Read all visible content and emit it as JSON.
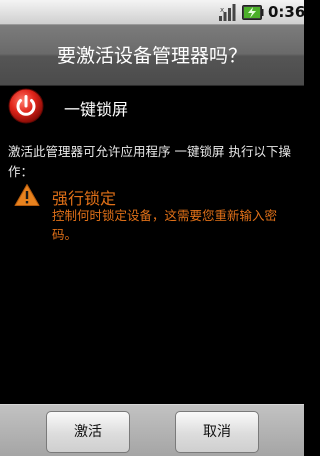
{
  "status_bar": {
    "time": "0:36",
    "icons": [
      "signal-bars-icon",
      "battery-charging-icon"
    ]
  },
  "dialog": {
    "title": "要激活设备管理器吗？",
    "app": {
      "icon": "power-icon",
      "name": "一键锁屏"
    },
    "description": "激活此管理器可允许应用程序 一键锁屏 执行以下操作：",
    "policy": {
      "icon": "warning-triangle-icon",
      "title": "强行锁定",
      "description": "控制何时锁定设备，这需要您重新输入密码。",
      "color": "#e07018"
    },
    "buttons": {
      "activate": "激活",
      "cancel": "取消"
    }
  }
}
